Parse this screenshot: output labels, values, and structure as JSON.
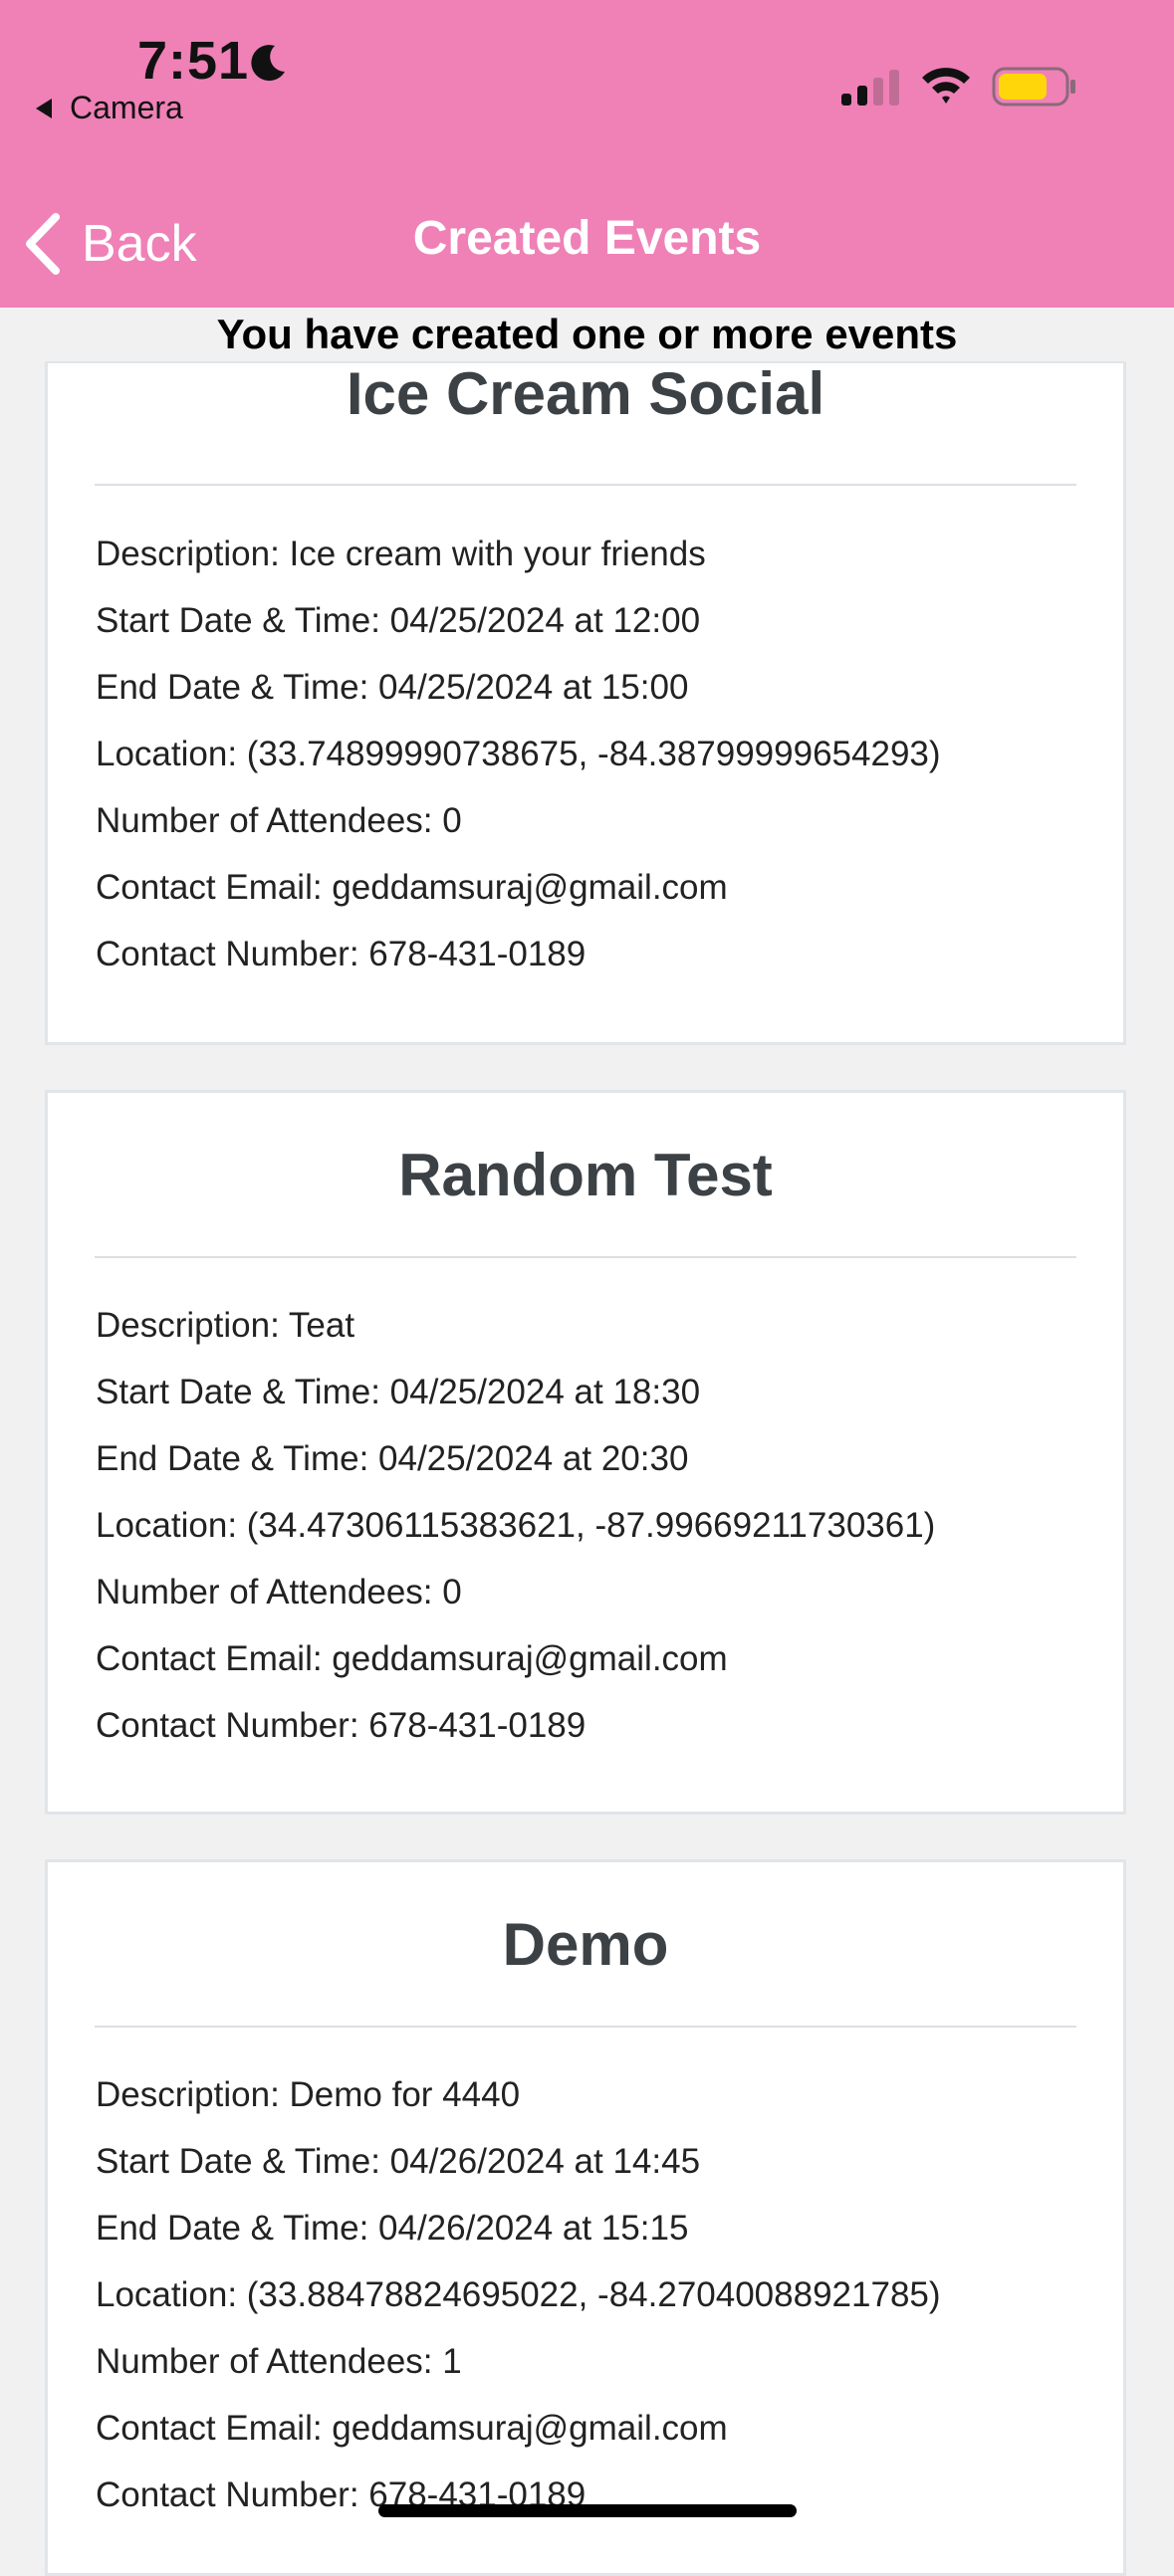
{
  "status_bar": {
    "time": "7:51",
    "back_app": "Camera",
    "icons": [
      "moon-icon",
      "signal-icon",
      "wifi-icon",
      "battery-icon"
    ]
  },
  "nav": {
    "back_label": "Back",
    "title": "Created Events"
  },
  "subheader": "You have created one or more events",
  "colors": {
    "header_bg": "#ef81b7",
    "battery": "#ffd60a"
  },
  "events": [
    {
      "title": "Ice Cream Social",
      "description": "Description: Ice cream with your friends",
      "start": "Start Date & Time: 04/25/2024 at 12:00",
      "end": "End Date & Time: 04/25/2024 at 15:00",
      "location": "Location: (33.74899990738675, -84.38799999654293)",
      "attendees": "Number of Attendees: 0",
      "email": "Contact Email: geddamsuraj@gmail.com",
      "phone": "Contact Number: 678-431-0189"
    },
    {
      "title": "Random Test",
      "description": "Description: Teat",
      "start": "Start Date & Time: 04/25/2024 at 18:30",
      "end": "End Date & Time: 04/25/2024 at 20:30",
      "location": "Location: (34.47306115383621, -87.99669211730361)",
      "attendees": "Number of Attendees: 0",
      "email": "Contact Email: geddamsuraj@gmail.com",
      "phone": "Contact Number: 678-431-0189"
    },
    {
      "title": "Demo",
      "description": "Description: Demo for 4440",
      "start": "Start Date & Time: 04/26/2024 at 14:45",
      "end": "End Date & Time: 04/26/2024 at 15:15",
      "location": "Location: (33.88478824695022, -84.27040088921785)",
      "attendees": "Number of Attendees: 1",
      "email": "Contact Email: geddamsuraj@gmail.com",
      "phone": "Contact Number: 678-431-0189"
    }
  ]
}
